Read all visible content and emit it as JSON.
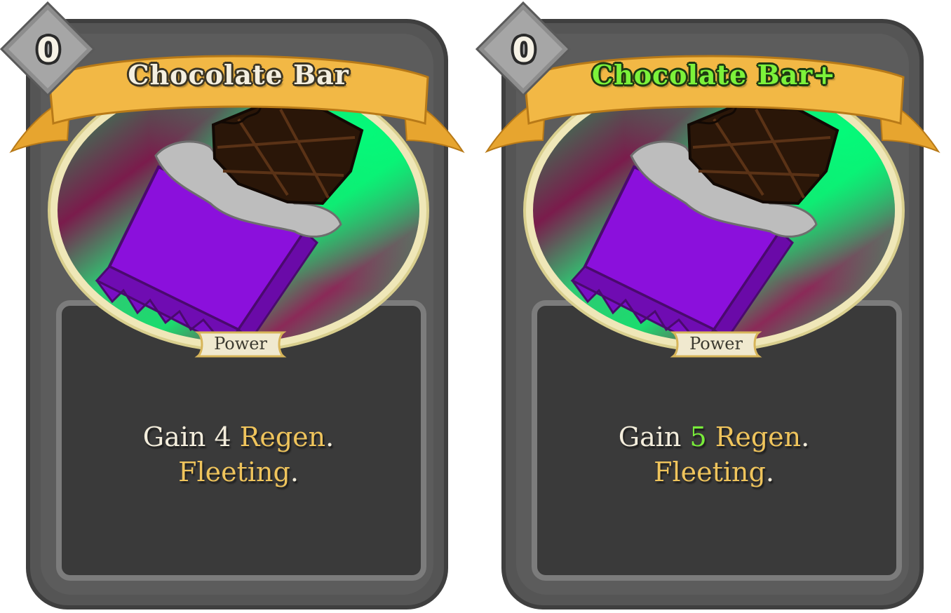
{
  "cards": [
    {
      "cost": "0",
      "title": "Chocolate Bar",
      "type": "Power",
      "desc": {
        "l1_pre": "Gain ",
        "amount": "4",
        "l1_kw": "Regen",
        "l1_end": ".",
        "l2_kw": "Fleeting",
        "l2_end": "."
      }
    },
    {
      "cost": "0",
      "title": "Chocolate Bar+",
      "type": "Power",
      "desc": {
        "l1_pre": "Gain ",
        "amount": "5",
        "l1_kw": "Regen",
        "l1_end": ".",
        "l2_kw": "Fleeting",
        "l2_end": "."
      }
    }
  ],
  "colors": {
    "frame": "#5a5a5a",
    "banner": "#f0b43c",
    "keyword": "#efc45c",
    "upgrade": "#79ec3a",
    "wrapper": "#8a10d8",
    "chocolate": "#2a1608"
  },
  "icons": [
    "energy-orb-icon",
    "chocolate-bar-art"
  ]
}
